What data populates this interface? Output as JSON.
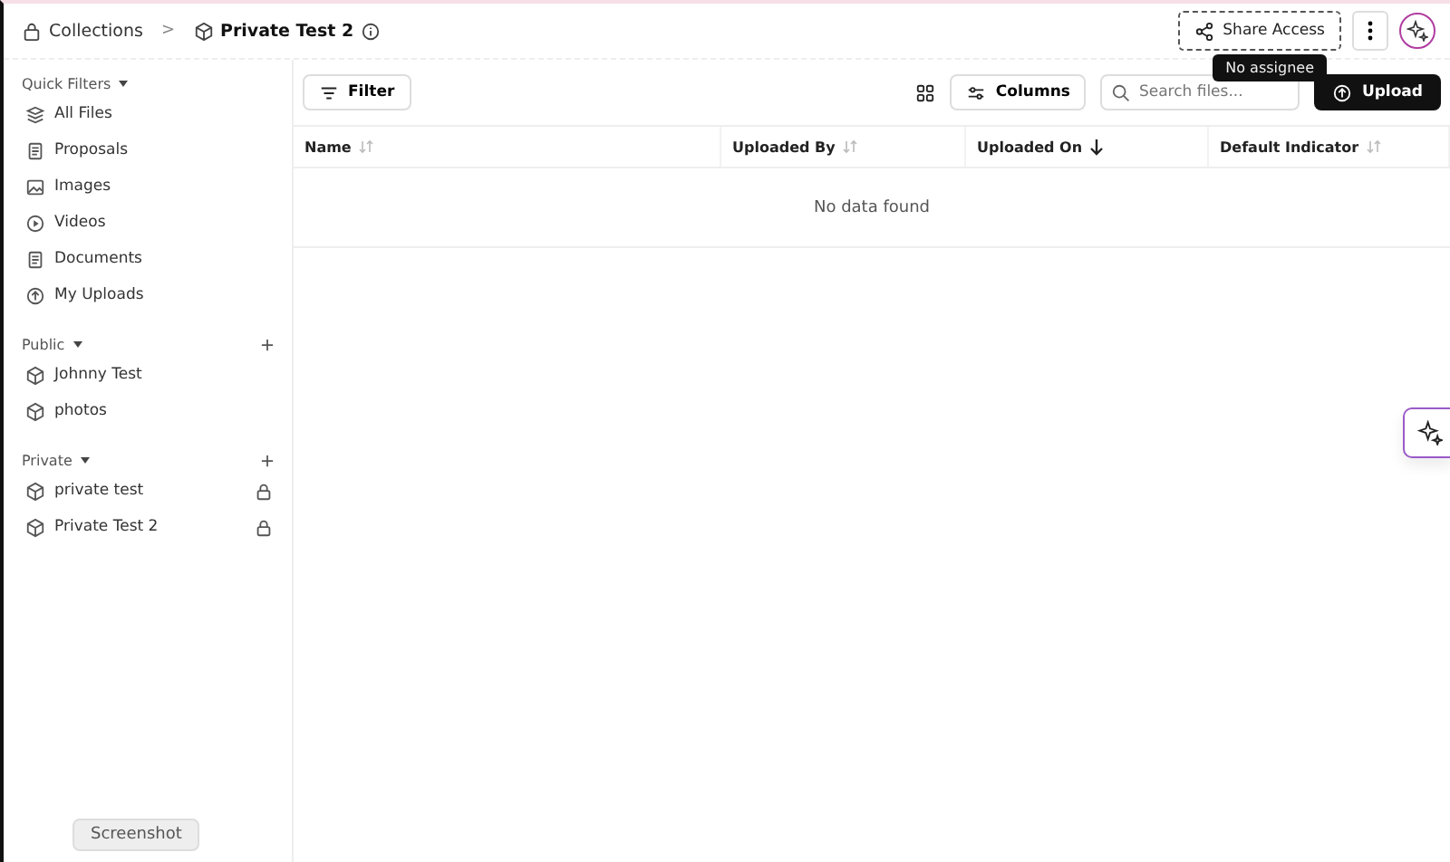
{
  "breadcrumb": {
    "separator": ">",
    "items": [
      {
        "label": "Collections",
        "kind": "lock"
      },
      {
        "label": "Private Test 2",
        "kind": "cube"
      }
    ]
  },
  "header": {
    "share_button": "Share Access",
    "tooltip": "No assignee"
  },
  "sidebar": {
    "sections": [
      {
        "title": "Quick Filters",
        "addable": false,
        "items": [
          {
            "label": "All Files",
            "kind": "layers",
            "locked": false
          },
          {
            "label": "Proposals",
            "kind": "doc",
            "locked": false
          },
          {
            "label": "Images",
            "kind": "image",
            "locked": false
          },
          {
            "label": "Videos",
            "kind": "play",
            "locked": false
          },
          {
            "label": "Documents",
            "kind": "doc",
            "locked": false
          },
          {
            "label": "My Uploads",
            "kind": "upload",
            "locked": false
          }
        ]
      },
      {
        "title": "Public",
        "addable": true,
        "items": [
          {
            "label": "Johnny Test",
            "kind": "cube",
            "locked": false
          },
          {
            "label": "photos",
            "kind": "cube",
            "locked": false
          }
        ]
      },
      {
        "title": "Private",
        "addable": true,
        "items": [
          {
            "label": "private test",
            "kind": "cube",
            "locked": true
          },
          {
            "label": "Private Test 2",
            "kind": "cube",
            "locked": true
          }
        ]
      }
    ]
  },
  "toolbar": {
    "filter": "Filter",
    "columns": "Columns",
    "search": {
      "placeholder": "Search files..."
    },
    "upload": "Upload"
  },
  "table": {
    "columns": [
      {
        "label": "Name",
        "sorted": false
      },
      {
        "label": "Uploaded By",
        "sorted": false
      },
      {
        "label": "Uploaded On",
        "sorted": true
      },
      {
        "label": "Default Indicator",
        "sorted": false
      }
    ],
    "empty": "No data found"
  },
  "dock_tooltip": "Screenshot"
}
